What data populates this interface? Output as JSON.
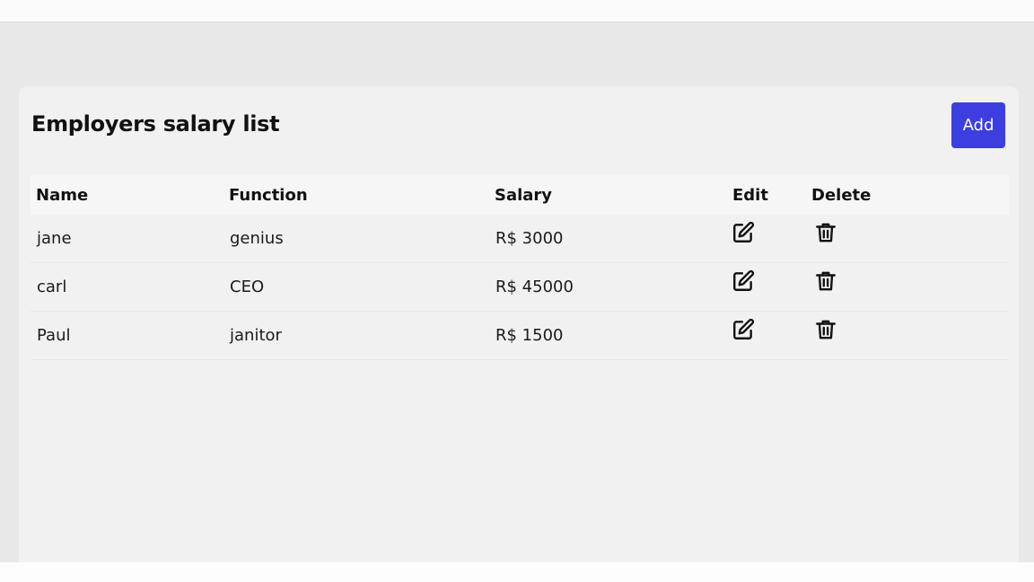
{
  "page": {
    "title": "Employers salary list",
    "add_label": "Add"
  },
  "table": {
    "headers": {
      "name": "Name",
      "function": "Function",
      "salary": "Salary",
      "edit": "Edit",
      "delete": "Delete"
    },
    "rows": [
      {
        "name": "jane",
        "function": "genius",
        "salary": "R$ 3000",
        "edit_icon": "edit-icon",
        "delete_icon": "trash-icon"
      },
      {
        "name": "carl",
        "function": "CEO",
        "salary": "R$ 45000",
        "edit_icon": "edit-icon",
        "delete_icon": "trash-icon"
      },
      {
        "name": "Paul",
        "function": "janitor",
        "salary": "R$ 1500",
        "edit_icon": "edit-icon",
        "delete_icon": "trash-icon"
      }
    ]
  },
  "colors": {
    "accent": "#3d3ee0",
    "background": "#e8e8e8",
    "card": "#f1f1f1"
  }
}
